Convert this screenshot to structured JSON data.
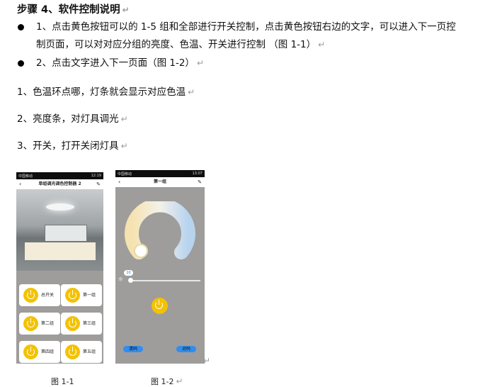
{
  "heading": "步骤 4、软件控制说明",
  "bullets": [
    {
      "line1": "1、点击黄色按钮可以的 1-5 组和全部进行开关控制，点击黄色按钮右边的文字，可以进入下一页控",
      "line2": "制页面，可以对对应分组的亮度、色温、开关进行控制  （图 1-1）"
    },
    {
      "line1": "2、点击文字进入下一页面（图 1-2）"
    }
  ],
  "paragraphs": [
    "1、色温环点哪，灯条就会显示对应色温",
    "2、亮度条，对灯具调光",
    "3、开关，打开关闭灯具"
  ],
  "pilcrow": "↵",
  "phone1": {
    "title": "单组调光调色控制器 2",
    "status_left": "中国移动",
    "status_right": "12:19",
    "buttons": [
      "总开关",
      "第一组",
      "第二组",
      "第三组",
      "第四组",
      "第五组"
    ]
  },
  "phone2": {
    "title": "第一组",
    "status_left": "中国移动",
    "status_right": "13:07",
    "brightness_value": "10",
    "brightness_level": 0.03,
    "left_button": "清码",
    "right_button": "对码"
  },
  "captions": [
    "图 1-1",
    "图 1-2"
  ]
}
